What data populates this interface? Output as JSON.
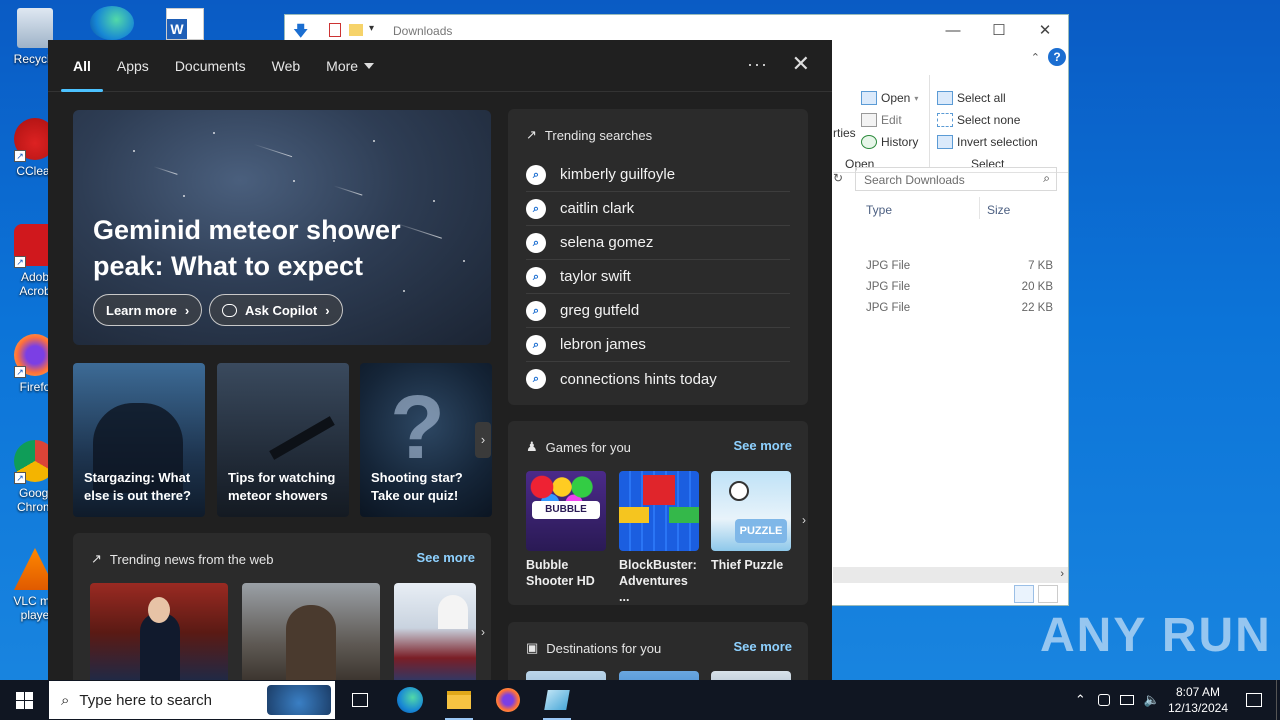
{
  "desktop": {
    "icons": [
      {
        "label": "Recycle"
      },
      {
        "label": "CClear"
      },
      {
        "label": "Adob Acrob"
      },
      {
        "label": "Firefo"
      },
      {
        "label": "Googl Chrom"
      },
      {
        "label": "VLC me playe"
      }
    ]
  },
  "explorer": {
    "title": "Downloads",
    "ribbon": {
      "open_partial": "rties",
      "open": "Open",
      "edit": "Edit",
      "history": "History",
      "open_group": "Open",
      "select_all": "Select all",
      "select_none": "Select none",
      "invert_selection": "Invert selection",
      "select_group": "Select"
    },
    "search_placeholder": "Search Downloads",
    "columns": {
      "type": "Type",
      "size": "Size"
    },
    "rows": [
      {
        "type": "JPG File",
        "size": "7 KB"
      },
      {
        "type": "JPG File",
        "size": "20 KB"
      },
      {
        "type": "JPG File",
        "size": "22 KB"
      }
    ]
  },
  "search": {
    "tabs": [
      "All",
      "Apps",
      "Documents",
      "Web",
      "More"
    ],
    "hero": {
      "title": "Geminid meteor shower peak: What to expect",
      "learn_more": "Learn more",
      "ask_copilot": "Ask Copilot"
    },
    "cards": [
      {
        "text": "Stargazing: What else is out there?"
      },
      {
        "text": "Tips for watching meteor showers"
      },
      {
        "text": "Shooting star? Take our quiz!"
      }
    ],
    "trending_news": {
      "title": "Trending news from the web",
      "see_more": "See more"
    },
    "trending_searches": {
      "title": "Trending searches",
      "items": [
        "kimberly guilfoyle",
        "caitlin clark",
        "selena gomez",
        "taylor swift",
        "greg gutfeld",
        "lebron james",
        "connections hints today"
      ]
    },
    "games": {
      "title": "Games for you",
      "see_more": "See more",
      "items": [
        {
          "name": "Bubble Shooter HD"
        },
        {
          "name": "BlockBuster: Adventures ..."
        },
        {
          "name": "Thief Puzzle"
        }
      ]
    },
    "destinations": {
      "title": "Destinations for you",
      "see_more": "See more"
    }
  },
  "taskbar": {
    "search_placeholder": "Type here to search",
    "time": "8:07 AM",
    "date": "12/13/2024"
  },
  "watermark": "ANY RUN"
}
